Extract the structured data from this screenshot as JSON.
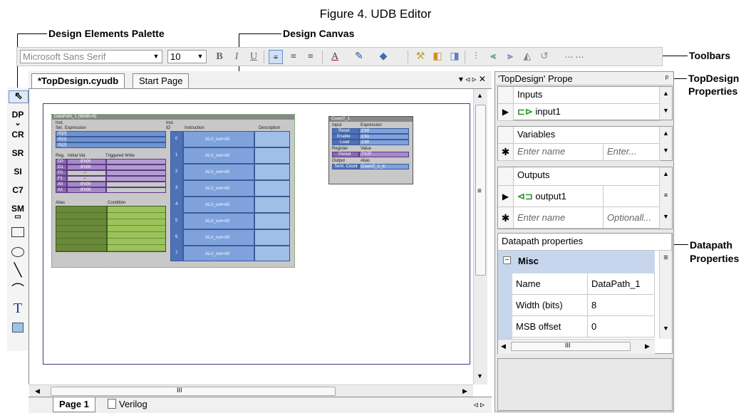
{
  "figure_title": "Figure 4. UDB Editor",
  "callouts": {
    "palette": "Design Elements Palette",
    "canvas": "Design Canvas",
    "toolbars": "Toolbars",
    "topdesign_props": [
      "TopDesign",
      "Properties"
    ],
    "datapath_props": [
      "Datapath",
      "Properties"
    ]
  },
  "toolbar": {
    "font_name": "Microsoft Sans Serif",
    "font_size": "10",
    "bold": "B",
    "italic": "I",
    "underline": "U"
  },
  "palette": {
    "items": [
      "DP",
      "CR",
      "SR",
      "SI",
      "C7",
      "SM"
    ]
  },
  "tabs": {
    "design": "*TopDesign.cyudb",
    "start": "Start Page",
    "nav": "▾ ◃ ▹ ✕"
  },
  "datapath": {
    "title": "DataPath_1 (Width=8)",
    "inst_label": "Inst.",
    "sel_label": "Sel.",
    "expression_label": "Expression",
    "sel_rows": [
      "IS[0]",
      "IS[1]",
      "IS[2]"
    ],
    "reg_headers": [
      "Reg.",
      "Initial Val.",
      "Triggered Write"
    ],
    "regs": [
      {
        "name": "D0",
        "val": "8'h00"
      },
      {
        "name": "D1",
        "val": "8'h00"
      },
      {
        "name": "F0",
        "val": "--"
      },
      {
        "name": "F1",
        "val": "--"
      },
      {
        "name": "A0",
        "val": "8'h00"
      },
      {
        "name": "A1",
        "val": "8'h00"
      }
    ],
    "alias_label": "Alias",
    "condition_label": "Condition",
    "instr_headers": [
      "Inst.",
      "ID",
      "Instruction",
      "Description"
    ],
    "instr_ids": [
      "0",
      "1",
      "2",
      "3",
      "4",
      "5",
      "6",
      "7"
    ],
    "instr_text": "ALU_out=A0"
  },
  "counter": {
    "title": "Count7_1",
    "input_label": "Input",
    "expression_label": "Expression",
    "inputs": [
      {
        "name": "Reset",
        "expr": "1'b0"
      },
      {
        "name": "Enable",
        "expr": "1'b1"
      },
      {
        "name": "Load",
        "expr": "1'b0"
      }
    ],
    "register_label": "Register",
    "value_label": "Value",
    "period_name": "Period",
    "period_val": "7'h7F",
    "output_label": "Output",
    "alias_label": "Alias",
    "term_name": "Term. Count",
    "term_alias": "Count7_1_tc"
  },
  "bottom_tabs": {
    "page1": "Page 1",
    "verilog": "Verilog",
    "nav": "◃ ▹"
  },
  "hscroll_grip": "III",
  "props_panel": {
    "title": "'TopDesign' Prope",
    "inputs_header": "Inputs",
    "input1": "input1",
    "variables_header": "Variables",
    "enter_name": "Enter name",
    "enter_short": "Enter...",
    "outputs_header": "Outputs",
    "output1": "output1",
    "optional": "Optionall..."
  },
  "datapath_props": {
    "title": "Datapath properties",
    "category": "Misc",
    "rows": [
      {
        "name": "Name",
        "value": "DataPath_1"
      },
      {
        "name": "Width (bits)",
        "value": "8"
      },
      {
        "name": "MSB offset",
        "value": "0"
      }
    ],
    "scroll_grip": "III"
  }
}
